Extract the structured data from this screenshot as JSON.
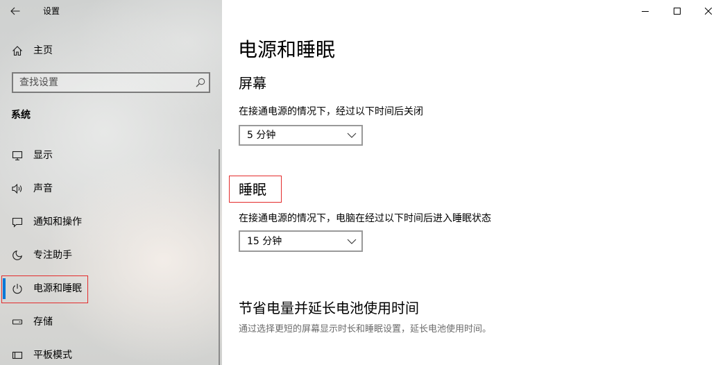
{
  "window": {
    "title": "设置",
    "back_icon": "back-arrow-icon",
    "minimize_icon": "minimize-icon",
    "maximize_icon": "maximize-icon",
    "close_icon": "close-icon"
  },
  "sidebar": {
    "home": {
      "label": "主页",
      "icon": "home-icon"
    },
    "search": {
      "placeholder": "查找设置",
      "icon": "search-icon"
    },
    "section_title": "系统",
    "items": [
      {
        "label": "显示",
        "icon": "monitor-icon",
        "selected": false
      },
      {
        "label": "声音",
        "icon": "speaker-icon",
        "selected": false
      },
      {
        "label": "通知和操作",
        "icon": "message-icon",
        "selected": false
      },
      {
        "label": "专注助手",
        "icon": "moon-icon",
        "selected": false
      },
      {
        "label": "电源和睡眠",
        "icon": "power-icon",
        "selected": true
      },
      {
        "label": "存储",
        "icon": "hard-drive-icon",
        "selected": false
      },
      {
        "label": "平板模式",
        "icon": "tablet-icon",
        "selected": false
      }
    ]
  },
  "main": {
    "title": "电源和睡眠",
    "screen": {
      "heading": "屏幕",
      "description": "在接通电源的情况下，经过以下时间后关闭",
      "timeout": "5 分钟",
      "dropdown_icon": "chevron-down-icon"
    },
    "sleep": {
      "heading": "睡眠",
      "description": "在接通电源的情况下，电脑在经过以下时间后进入睡眠状态",
      "timeout": "15 分钟",
      "dropdown_icon": "chevron-down-icon"
    },
    "battery": {
      "heading": "节省电量并延长电池使用时间",
      "description": "通过选择更短的屏幕显示时长和睡眠设置，延长电池使用时间。"
    }
  },
  "colors": {
    "accent": "#0078d7",
    "annotation": "#e32b2b",
    "text": "#000000",
    "secondary_text": "#6b6b6b"
  }
}
